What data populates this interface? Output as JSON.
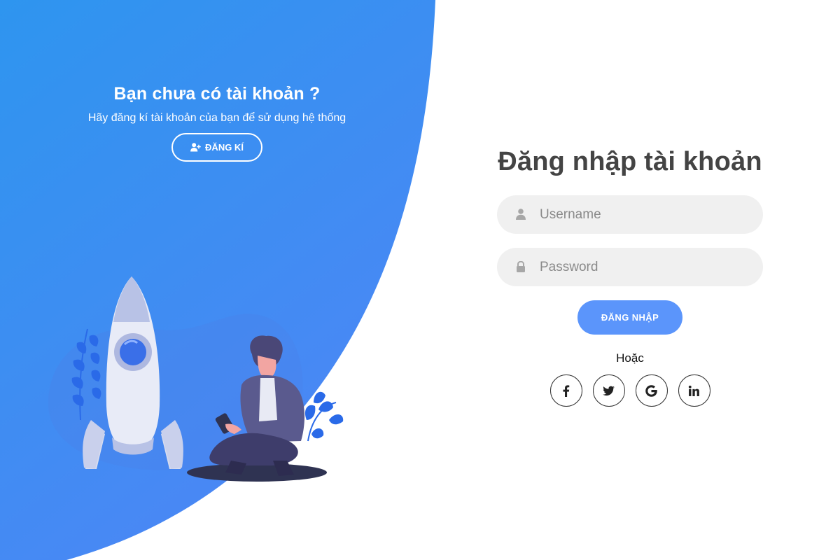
{
  "colors": {
    "gradient_top": "#2e8ff0",
    "gradient_bottom": "#4a8af4",
    "button_blue": "#5b95fb",
    "field_bg": "#f0f0f0",
    "title_gray": "#444444"
  },
  "signup_panel": {
    "title": "Bạn chưa có tài khoản ?",
    "subtitle": "Hãy đăng kí tài khoản của bạn để sử dụng hệ thống",
    "signup_label": "ĐĂNG KÍ",
    "signup_icon": "user-plus-icon"
  },
  "login_panel": {
    "title": "Đăng nhập tài khoản",
    "username": {
      "placeholder": "Username",
      "value": "",
      "icon": "user-icon"
    },
    "password": {
      "placeholder": "Password",
      "value": "",
      "icon": "lock-icon"
    },
    "login_label": "ĐĂNG NHẬP",
    "or_text": "Hoặc",
    "socials": [
      {
        "name": "facebook",
        "icon": "facebook-icon"
      },
      {
        "name": "twitter",
        "icon": "twitter-icon"
      },
      {
        "name": "google",
        "icon": "google-icon"
      },
      {
        "name": "linkedin",
        "icon": "linkedin-icon"
      }
    ]
  },
  "illustration": {
    "subjects": [
      "rocket-icon",
      "person-with-phone",
      "plant-leaves"
    ]
  }
}
